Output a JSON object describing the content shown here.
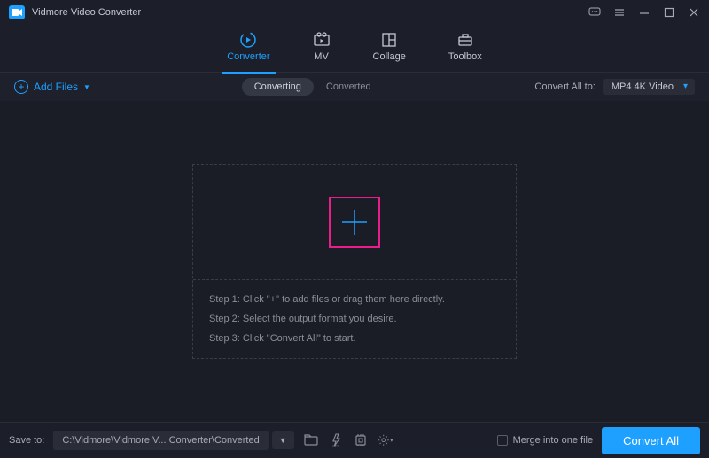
{
  "title": "Vidmore Video Converter",
  "nav": {
    "tabs": [
      {
        "label": "Converter",
        "active": true
      },
      {
        "label": "MV",
        "active": false
      },
      {
        "label": "Collage",
        "active": false
      },
      {
        "label": "Toolbox",
        "active": false
      }
    ]
  },
  "subbar": {
    "add_files": "Add Files",
    "tab_converting": "Converting",
    "tab_converted": "Converted",
    "convert_all_to": "Convert All to:",
    "format": "MP4 4K Video"
  },
  "drop": {
    "step1": "Step 1: Click \"+\" to add files or drag them here directly.",
    "step2": "Step 2: Select the output format you desire.",
    "step3": "Step 3: Click \"Convert All\" to start."
  },
  "footer": {
    "save_to": "Save to:",
    "path": "C:\\Vidmore\\Vidmore V...  Converter\\Converted",
    "merge": "Merge into one file",
    "convert_all": "Convert All"
  }
}
